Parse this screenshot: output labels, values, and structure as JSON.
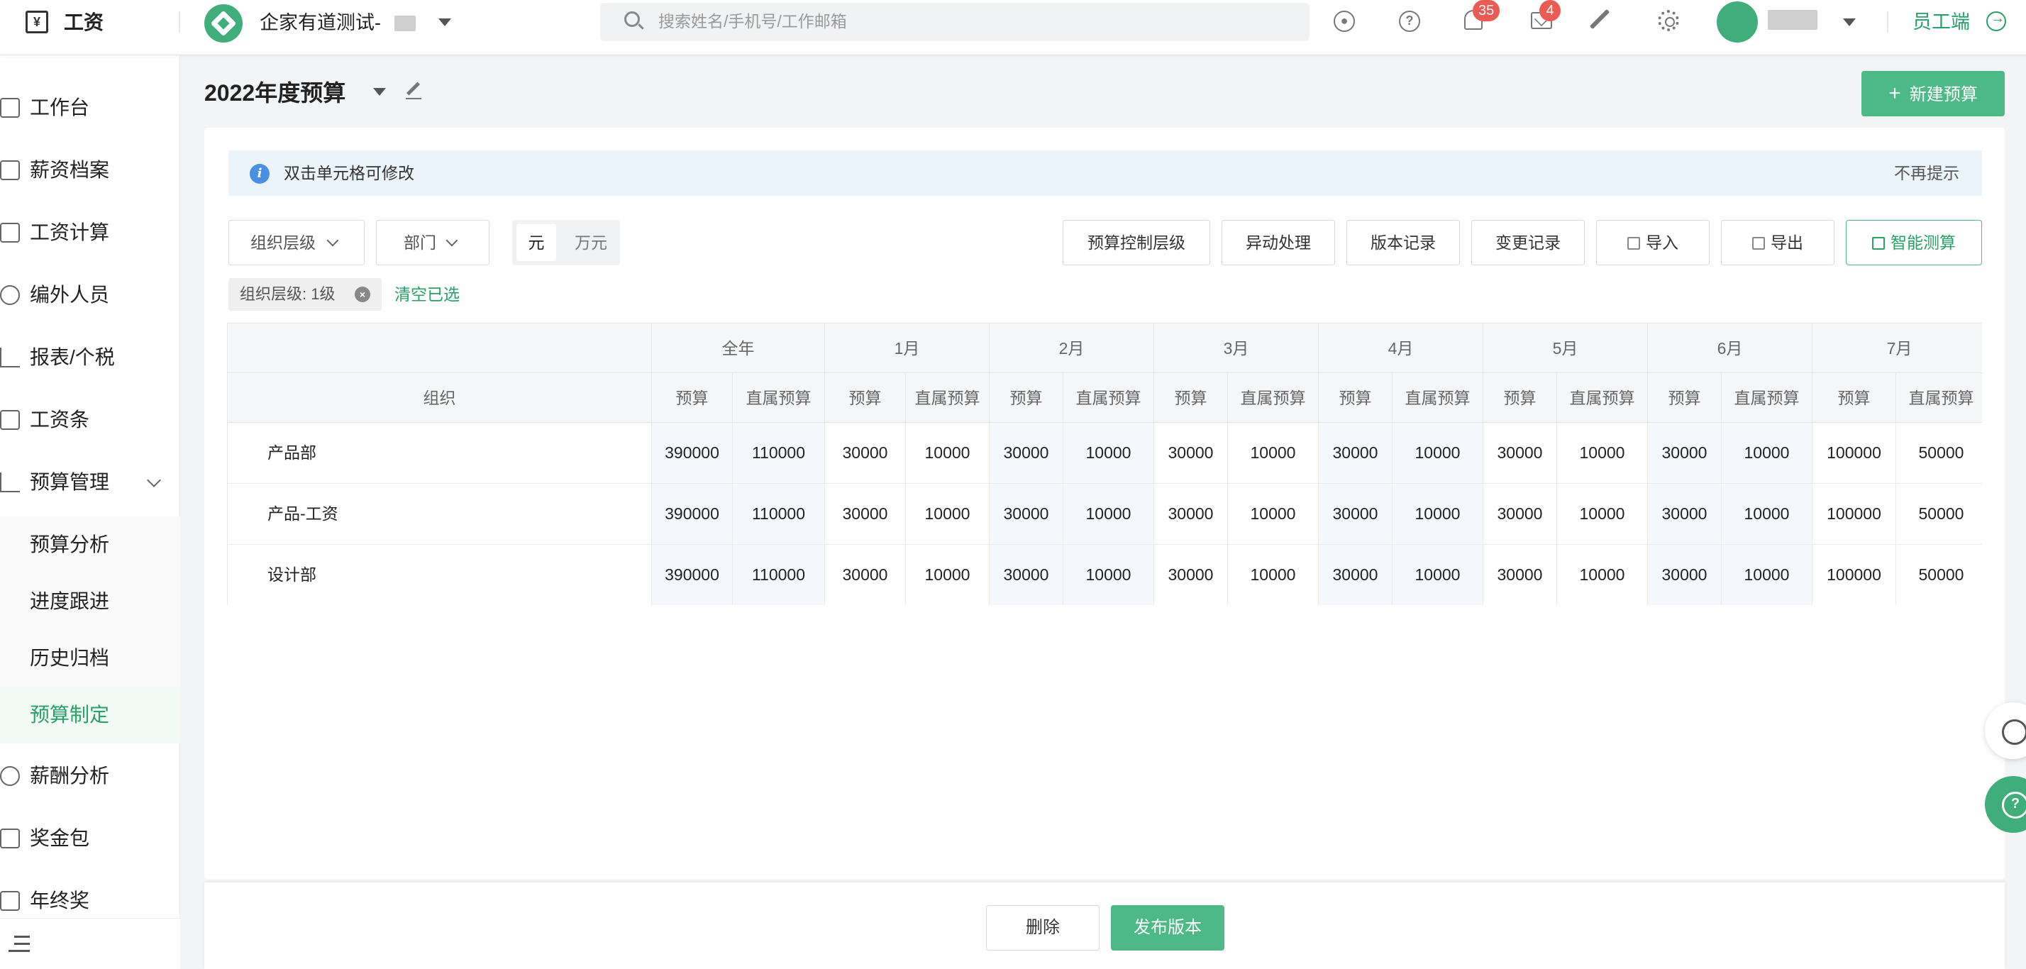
{
  "header": {
    "app_title": "工资",
    "company_name": "企家有道测试-",
    "search_placeholder": "搜索姓名/手机号/工作邮箱",
    "notification_count": "35",
    "message_count": "4",
    "employee_link": "员工端",
    "accent_color": "#26a267"
  },
  "sidebar": {
    "items": [
      {
        "label": "工作台",
        "icon": "monitor-icon"
      },
      {
        "label": "薪资档案",
        "icon": "profile-icon"
      },
      {
        "label": "工资计算",
        "icon": "calendar-icon"
      },
      {
        "label": "编外人员",
        "icon": "person-icon"
      },
      {
        "label": "报表/个税",
        "icon": "bar-chart-icon"
      },
      {
        "label": "工资条",
        "icon": "document-icon"
      },
      {
        "label": "预算管理",
        "icon": "trend-chart-icon"
      }
    ],
    "sub_items": [
      {
        "label": "预算分析"
      },
      {
        "label": "进度跟进"
      },
      {
        "label": "历史归档"
      },
      {
        "label": "预算制定",
        "active": true
      }
    ],
    "items_after": [
      {
        "label": "薪酬分析",
        "icon": "person-search-icon"
      },
      {
        "label": "奖金包",
        "icon": "wallet-icon"
      },
      {
        "label": "年终奖",
        "icon": "envelope-icon"
      }
    ]
  },
  "page": {
    "title": "2022年度预算",
    "new_button": "新建预算",
    "tip": "双击单元格可修改",
    "tip_dismiss": "不再提示"
  },
  "filters": {
    "org_level": "组织层级",
    "department": "部门",
    "unit_yuan": "元",
    "unit_wanyuan": "万元",
    "tag": "组织层级: 1级",
    "clear": "清空已选"
  },
  "toolbar": {
    "control_level": "预算控制层级",
    "exception": "异动处理",
    "version_log": "版本记录",
    "change_log": "变更记录",
    "import": "导入",
    "export": "导出",
    "smart_calc": "智能测算"
  },
  "table": {
    "org_header": "组织",
    "periods": [
      "全年",
      "1月",
      "2月",
      "3月",
      "4月",
      "5月",
      "6月",
      "7月"
    ],
    "sub_headers": [
      "预算",
      "直属预算"
    ],
    "rows": [
      {
        "org": "产品部",
        "values": [
          "390000",
          "110000",
          "30000",
          "10000",
          "30000",
          "10000",
          "30000",
          "10000",
          "30000",
          "10000",
          "30000",
          "10000",
          "30000",
          "10000",
          "100000",
          "50000"
        ]
      },
      {
        "org": "产品-工资",
        "values": [
          "390000",
          "110000",
          "30000",
          "10000",
          "30000",
          "10000",
          "30000",
          "10000",
          "30000",
          "10000",
          "30000",
          "10000",
          "30000",
          "10000",
          "100000",
          "50000"
        ]
      },
      {
        "org": "设计部",
        "values": [
          "390000",
          "110000",
          "30000",
          "10000",
          "30000",
          "10000",
          "30000",
          "10000",
          "30000",
          "10000",
          "30000",
          "10000",
          "30000",
          "10000",
          "100000",
          "50000"
        ]
      }
    ]
  },
  "footer": {
    "delete": "删除",
    "publish": "发布版本"
  }
}
